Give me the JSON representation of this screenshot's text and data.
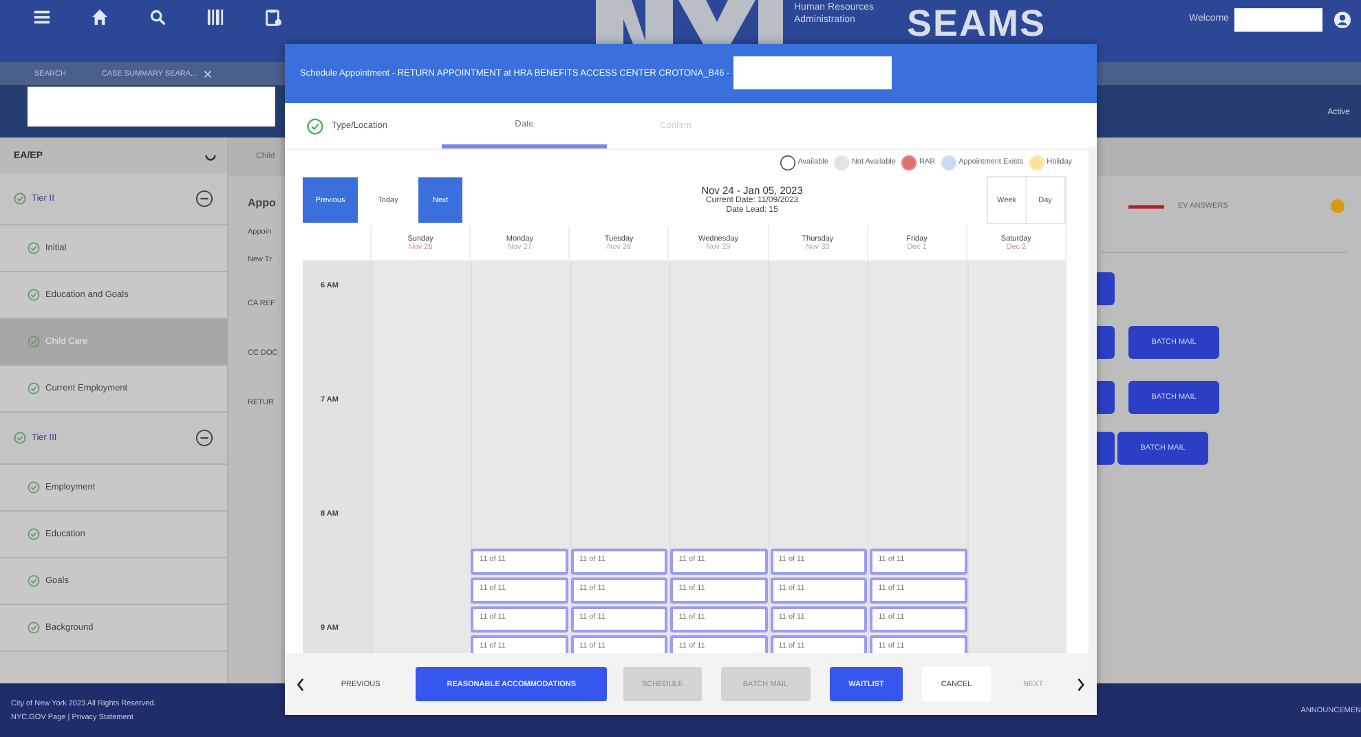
{
  "header": {
    "org_lines": [
      "Human Resources",
      "Administration"
    ],
    "app_name": "SEAMS",
    "welcome": "Welcome"
  },
  "breadcrumbs": [
    {
      "label": "SEARCH",
      "closable": false
    },
    {
      "label": "CASE SUMMARY  SEARA...",
      "closable": true
    }
  ],
  "case_bar": {
    "status": "Active"
  },
  "sidebar": {
    "title": "EA/EP",
    "groups": [
      {
        "label": "Tier II",
        "expanded": true,
        "items": [
          {
            "label": "Initial",
            "selected": false
          },
          {
            "label": "Education and Goals",
            "selected": false
          },
          {
            "label": "Child Care",
            "selected": true
          },
          {
            "label": "Current Employment",
            "selected": false
          }
        ]
      },
      {
        "label": "Tier III",
        "expanded": true,
        "items": [
          {
            "label": "Employment",
            "selected": false
          },
          {
            "label": "Education",
            "selected": false
          },
          {
            "label": "Goals",
            "selected": false
          },
          {
            "label": "Background",
            "selected": false
          }
        ]
      }
    ]
  },
  "content": {
    "tab": "Child",
    "heading": "Appo",
    "labels": [
      "Appoin",
      "New Tr",
      "CA REF",
      "CC DOC",
      "RETUR"
    ],
    "ev_answers": "EV ANSWERS",
    "batch_buttons": [
      "BATCH MAIL",
      "BATCH MAIL",
      "BATCH MAIL"
    ]
  },
  "modal": {
    "title": "Schedule Appointment - RETURN APPOINTMENT at HRA BENEFITS ACCESS CENTER CROTONA_B46 -",
    "steps": [
      {
        "label": "Type/Location",
        "done": true,
        "selected": false
      },
      {
        "label": "Date",
        "done": false,
        "selected": true
      },
      {
        "label": "Confirm",
        "done": false,
        "selected": false
      }
    ],
    "legend": [
      {
        "label": "Available",
        "color": "#ffffff"
      },
      {
        "label": "Not Available",
        "color": "#e3e3e3"
      },
      {
        "label": "RAR",
        "color": "#e07070"
      },
      {
        "label": "Appointment Exists",
        "color": "#c5daf5"
      },
      {
        "label": "Holiday",
        "color": "#fde39a"
      }
    ],
    "nav_buttons": [
      {
        "label": "Previous",
        "kind": "primary"
      },
      {
        "label": "Today",
        "kind": "plain"
      },
      {
        "label": "Next",
        "kind": "primary"
      }
    ],
    "range": "Nov 24 - Jan 05, 2023",
    "current_date": "Current Date: 11/09/2023",
    "date_lead": "Date Lead: 15",
    "views": [
      "Week",
      "Day"
    ],
    "days": [
      {
        "name": "Sunday",
        "date": "Nov 26",
        "weekend": true
      },
      {
        "name": "Monday",
        "date": "Nov 27",
        "weekend": false
      },
      {
        "name": "Tuesday",
        "date": "Nov 28",
        "weekend": false
      },
      {
        "name": "Wednesday",
        "date": "Nov 29",
        "weekend": false
      },
      {
        "name": "Thursday",
        "date": "Nov 30",
        "weekend": false
      },
      {
        "name": "Friday",
        "date": "Dec 1",
        "weekend": false
      },
      {
        "name": "Saturday",
        "date": "Dec 2",
        "weekend": true
      }
    ],
    "hours": [
      "6 AM",
      "7 AM",
      "8 AM",
      "9 AM"
    ],
    "slot_rows": [
      [
        "11 of 11",
        "11 of 11",
        "11 of 11",
        "11 of 11",
        "11 of 11"
      ],
      [
        "11 of 11",
        "11 of 11",
        "11 of 11",
        "11 of 11",
        "11 of 11"
      ],
      [
        "11 of 11",
        "11 of 11",
        "11 of 11",
        "11 of 11",
        "11 of 11"
      ],
      [
        "11 of 11",
        "11 of 11",
        "11 of 11",
        "11 of 11",
        "11 of 11"
      ]
    ],
    "footer": {
      "previous": "PREVIOUS",
      "buttons": [
        {
          "label": "REASONABLE ACCOMMODATIONS",
          "disabled": false
        },
        {
          "label": "SCHEDULE",
          "disabled": true
        },
        {
          "label": "BATCH MAIL",
          "disabled": true
        },
        {
          "label": "WAITLIST",
          "disabled": false
        }
      ],
      "cancel": "CANCEL",
      "next": {
        "label": "NEXT",
        "disabled": true
      }
    }
  },
  "page_footer": {
    "lines": [
      "City of New York 2023 All Rights Reserved.",
      "NYC.GOV Page | Privacy Statement"
    ],
    "announcements": "ANNOUNCEMEN"
  }
}
